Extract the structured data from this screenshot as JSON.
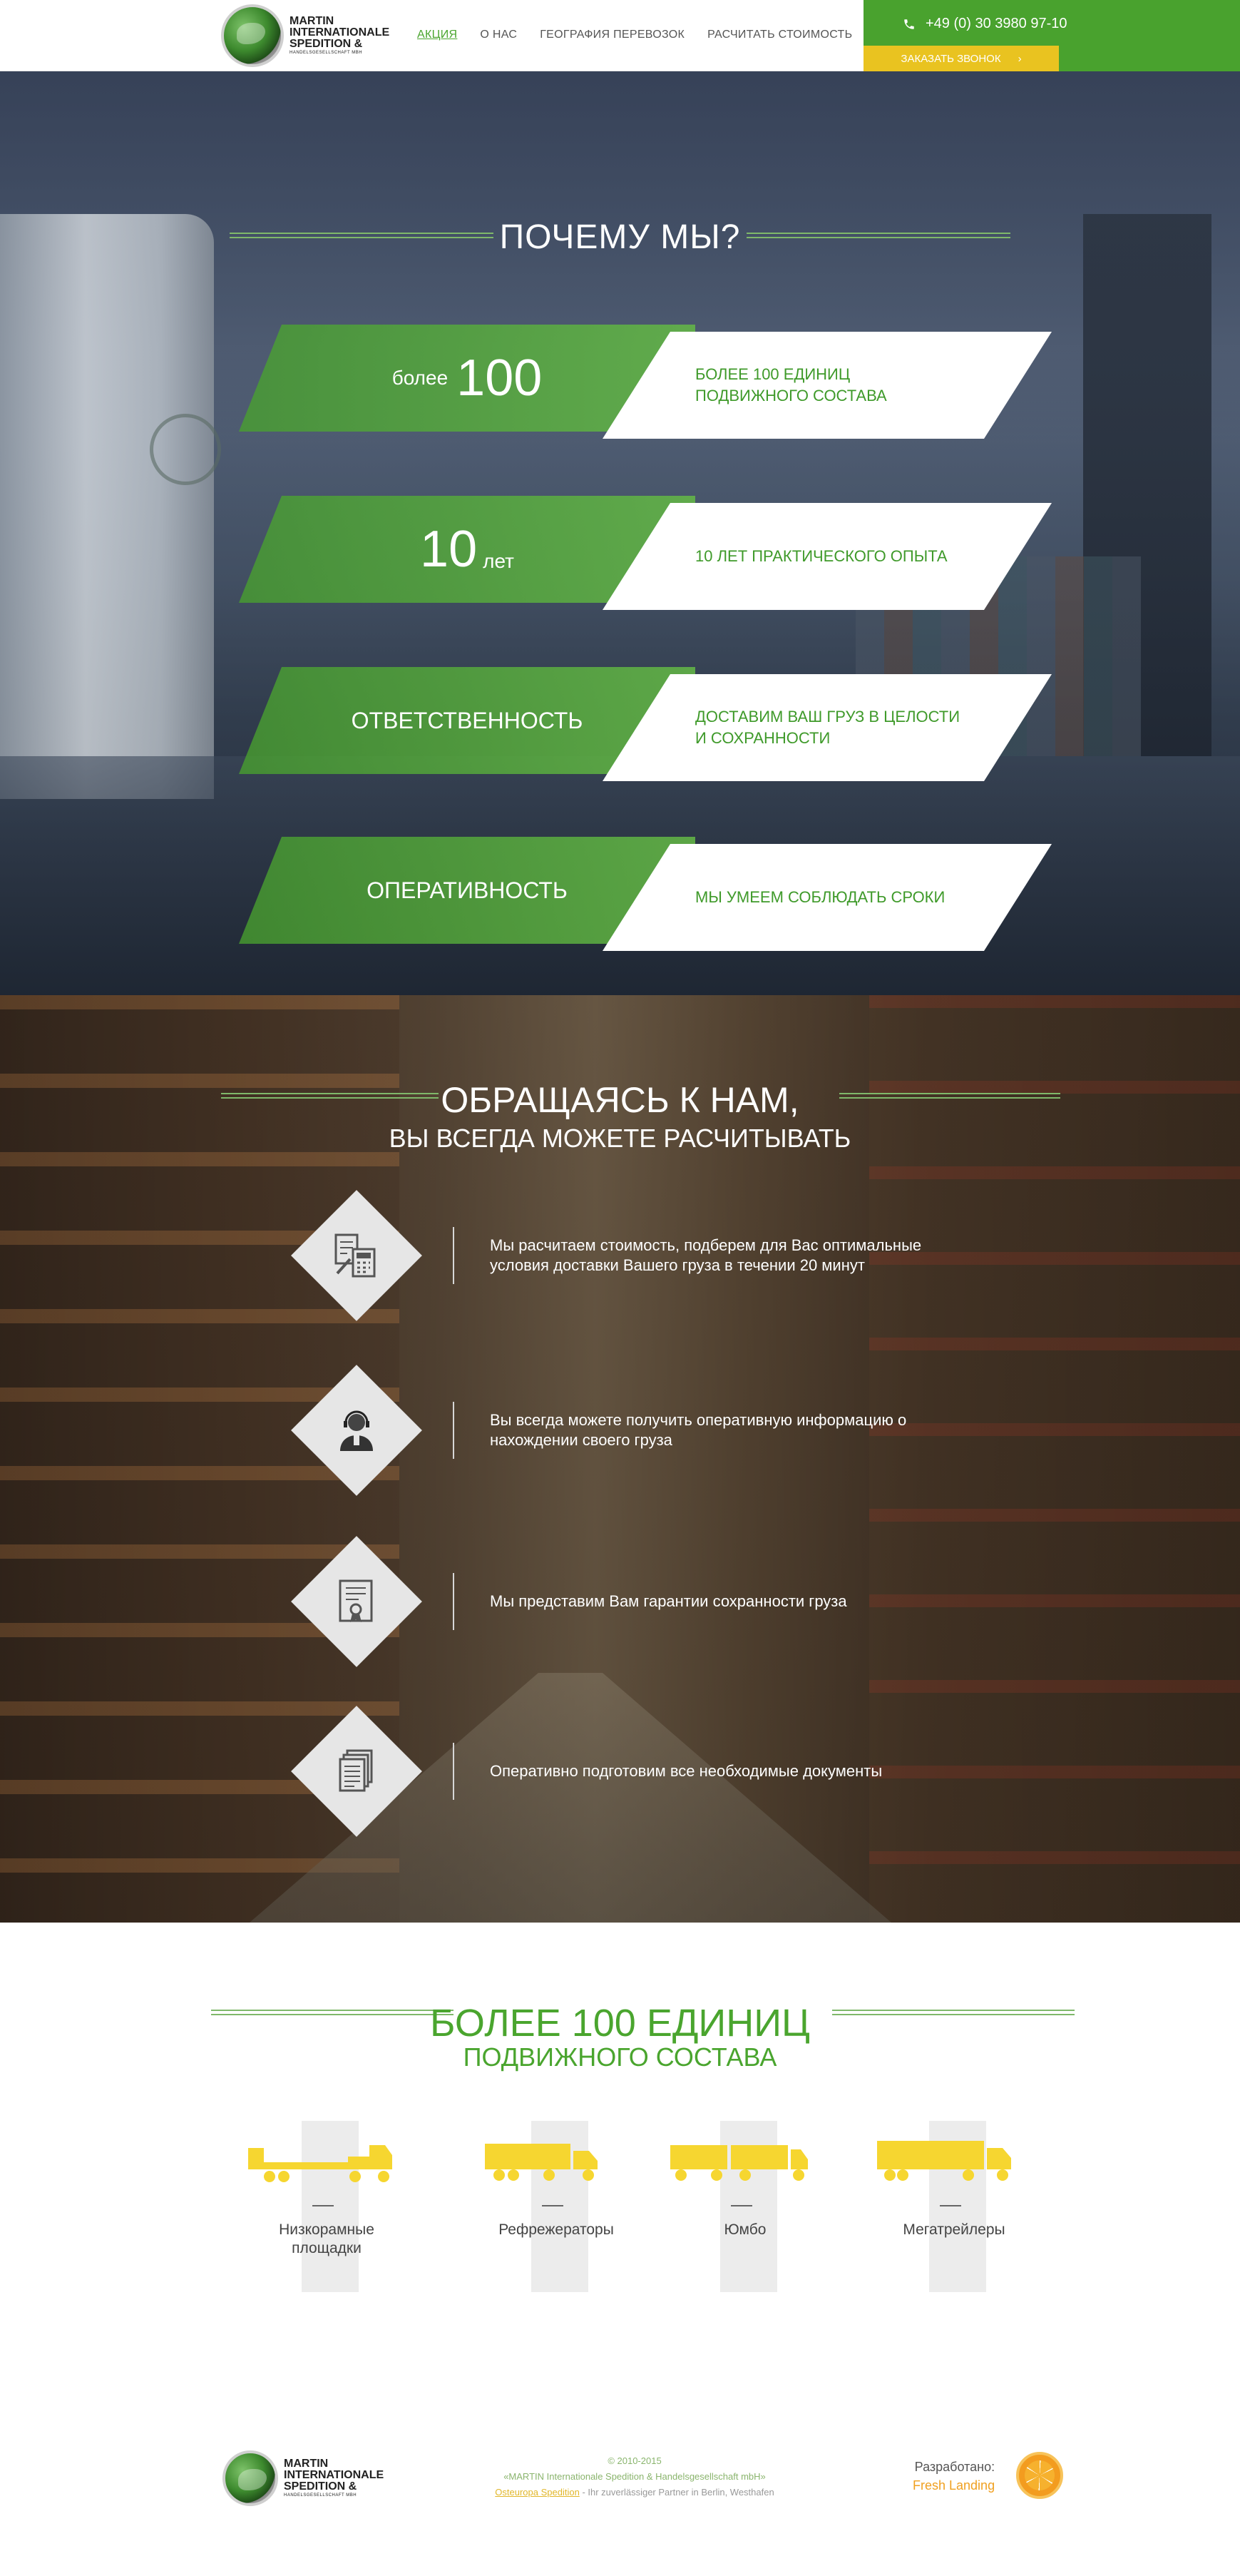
{
  "header": {
    "logo_line1": "MARTIN",
    "logo_line2": "INTERNATIONALE",
    "logo_line3": "SPEDITION &",
    "logo_line4": "HANDELSGESELLSCHAFT MBH",
    "nav": [
      "АКЦИЯ",
      "О НАС",
      "ГЕОГРАФИЯ ПЕРЕВОЗОК",
      "РАСЧИТАТЬ СТОИМОСТЬ"
    ],
    "phone": "+49 (0) 30 3980 97-10",
    "callback_label": "ЗАКАЗАТЬ ЗВОНОК",
    "callback_arrow": "›"
  },
  "why": {
    "title": "ПОЧЕМУ МЫ?",
    "rows": [
      {
        "prefix": "более",
        "big": "100",
        "suffix": "",
        "desc": "БОЛЕЕ 100 ЕДИНИЦ ПОДВИЖНОГО СОСТАВА"
      },
      {
        "prefix": "",
        "big": "10",
        "suffix": "лет",
        "desc": "10 ЛЕТ ПРАКТИЧЕСКОГО ОПЫТА"
      },
      {
        "label": "ОТВЕТСТВЕННОСТЬ",
        "desc": "ДОСТАВИМ ВАШ ГРУЗ В ЦЕЛОСТИ И СОХРАННОСТИ"
      },
      {
        "label": "ОПЕРАТИВНОСТЬ",
        "desc": "МЫ УМЕЕМ СОБЛЮДАТЬ СРОКИ"
      }
    ]
  },
  "count": {
    "title1": "ОБРАЩАЯСЬ К НАМ,",
    "title2": "ВЫ ВСЕГДА МОЖЕТЕ РАСЧИТЫВАТЬ",
    "features": [
      {
        "icon": "calculator-document-icon",
        "text": "Мы расчитаем стоимость, подберем для Вас оптимальные условия доставки Вашего груза в течении 20 минут"
      },
      {
        "icon": "operator-headset-icon",
        "text": "Вы всегда можете получить оперативную информацию о нахождении своего груза"
      },
      {
        "icon": "certificate-icon",
        "text": "Мы представим Вам гарантии сохранности груза"
      },
      {
        "icon": "documents-icon",
        "text": "Оперативно подготовим все необходимые документы"
      }
    ]
  },
  "fleet": {
    "title1": "БОЛЕЕ 100 ЕДИНИЦ",
    "title2": "ПОДВИЖНОГО СОСТАВА",
    "trucks": [
      {
        "icon": "lowbed-truck-icon",
        "label_line1": "Низкорамные",
        "label_line2": "площадки"
      },
      {
        "icon": "refrigerator-truck-icon",
        "label_line1": "Рефрежераторы",
        "label_line2": ""
      },
      {
        "icon": "jumbo-truck-icon",
        "label_line1": "Юмбо",
        "label_line2": ""
      },
      {
        "icon": "megatrailer-truck-icon",
        "label_line1": "Мегатрейлеры",
        "label_line2": ""
      }
    ],
    "truck_color": "#f6d630"
  },
  "footer": {
    "logo_line1": "MARTIN",
    "logo_line2": "INTERNATIONALE",
    "logo_line3": "SPEDITION &",
    "logo_line4": "HANDELSGESELLSCHAFT MBH",
    "copyright": "© 2010-2015",
    "company": "«MARTIN Internationale Spedition & Handelsgesellschaft mbH»",
    "link": "Osteuropa Spedition",
    "tagline": " - Ihr zuverlässiger Partner in Berlin, Westhafen",
    "dev_label": "Разработано:",
    "dev_brand": "Fresh Landing"
  },
  "colors": {
    "green": "#49a22e",
    "yellow": "#e9c320",
    "orange": "#f39c1f"
  }
}
